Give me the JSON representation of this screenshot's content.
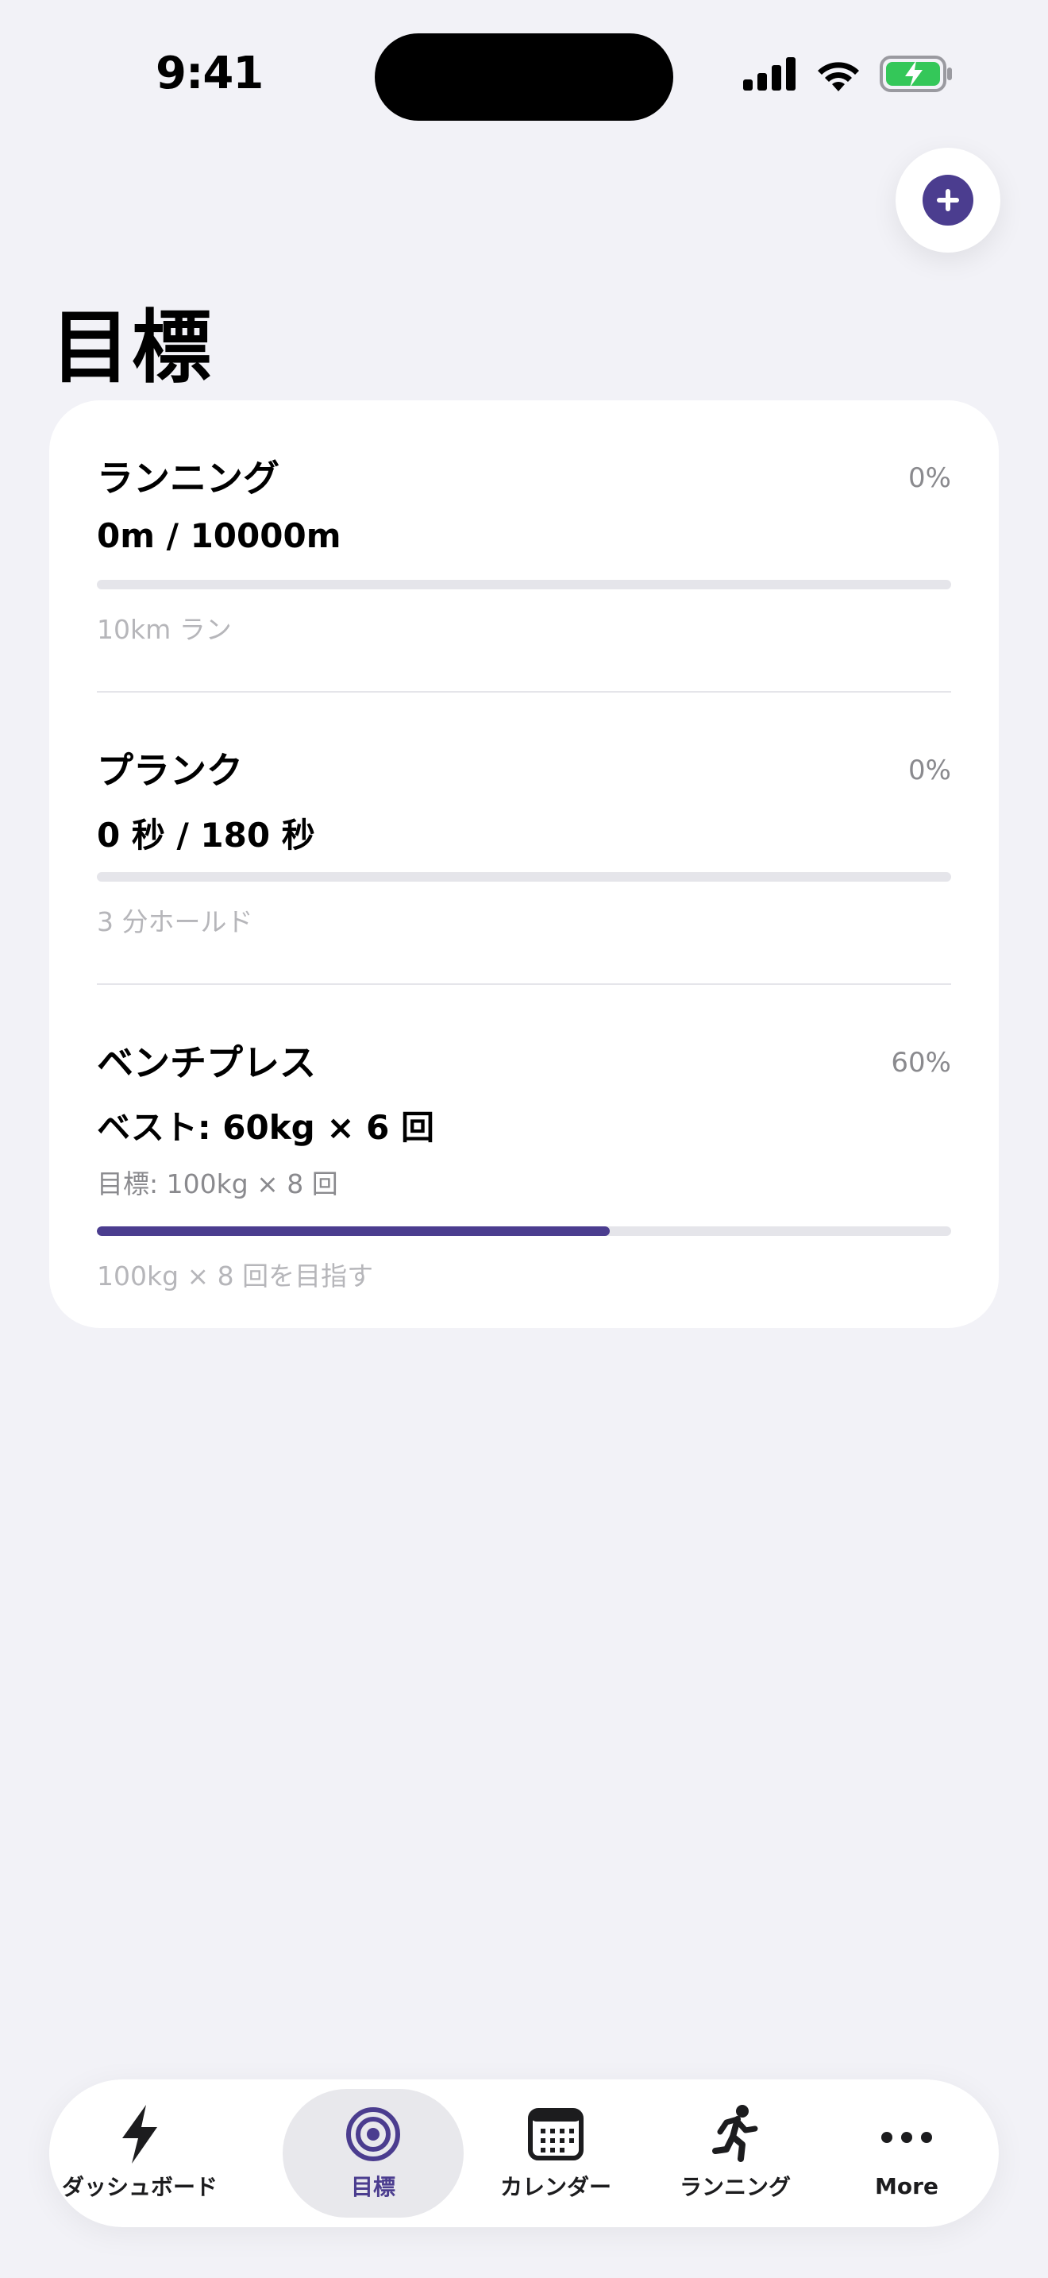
{
  "status_bar": {
    "time": "9:41"
  },
  "header": {
    "title": "目標",
    "add_button_icon": "plus-icon"
  },
  "goals": [
    {
      "name": "ランニング",
      "current": "0m / 10000m",
      "percent_label": "0%",
      "progress": 0,
      "note": "10km ラン"
    },
    {
      "name": "プランク",
      "current": "0 秒 / 180 秒",
      "percent_label": "0%",
      "progress": 0,
      "note": "3 分ホールド"
    },
    {
      "name": "ベンチプレス",
      "current": "ベスト: 60kg × 6 回",
      "target": "目標: 100kg × 8 回",
      "percent_label": "60%",
      "progress": 0.6,
      "note": "100kg × 8 回を目指す"
    }
  ],
  "tabbar": {
    "items": [
      {
        "label": "ダッシュボード",
        "icon": "lightning-bolt-icon",
        "active": false
      },
      {
        "label": "目標",
        "icon": "target-icon",
        "active": true
      },
      {
        "label": "カレンダー",
        "icon": "calendar-icon",
        "active": false
      },
      {
        "label": "ランニング",
        "icon": "runner-icon",
        "active": false
      },
      {
        "label": "More",
        "icon": "more-dots-icon",
        "active": false
      }
    ]
  },
  "colors": {
    "accent": "#4b3d8f",
    "background": "#f2f2f7",
    "battery": "#34c759"
  }
}
